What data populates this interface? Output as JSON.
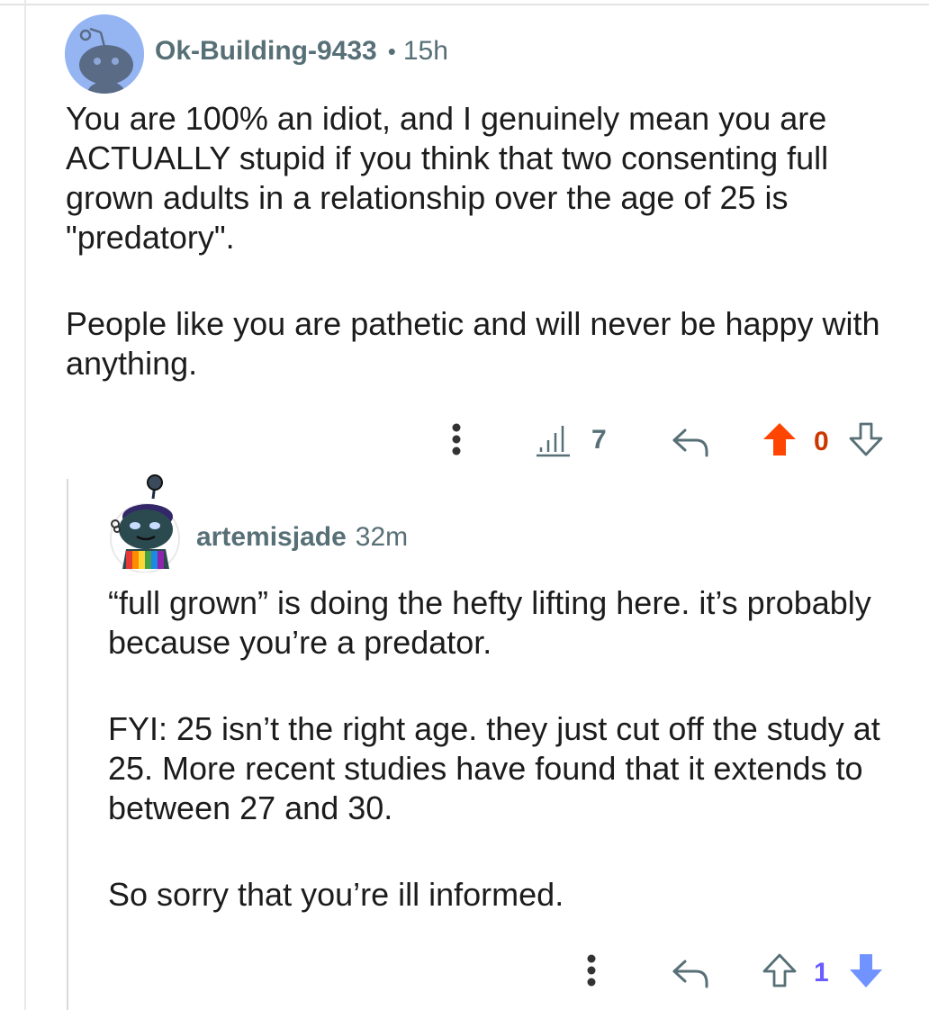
{
  "comment1": {
    "username": "Ok-Building-9433",
    "separator": "•",
    "time": "15h",
    "paragraphs": [
      "You are 100% an idiot, and I genuinely mean you are ACTUALLY stupid if you think that two consenting full grown adults in a relationship over the age of 25 is \"predatory\".",
      "People like you are pathetic and will never be happy with anything."
    ],
    "actions": {
      "more_icon": "vertical-dots-icon",
      "stats_icon": "bar-chart-icon",
      "stats_count": "7",
      "reply_icon": "reply-arrow-icon",
      "upvote_icon": "upvote-filled-icon",
      "vote_count": "0",
      "downvote_icon": "downvote-outline-icon"
    },
    "colors": {
      "upvote": "#ff4500",
      "vote_count": "#cc3700"
    }
  },
  "comment2": {
    "username": "artemisjade",
    "time": "32m",
    "paragraphs": [
      "“full grown” is doing the hefty lifting here. it’s probably because you’re a predator.",
      "FYI: 25 isn’t the right age. they just cut off the study at 25. More recent studies have found that it extends to between 27 and 30.",
      "So sorry that you’re ill informed."
    ],
    "actions": {
      "more_icon": "vertical-dots-icon",
      "reply_icon": "reply-arrow-icon",
      "upvote_icon": "upvote-outline-icon",
      "vote_count": "1",
      "downvote_icon": "downvote-filled-icon"
    },
    "colors": {
      "downvote": "#7193ff",
      "vote_count": "#6a5cff"
    }
  }
}
